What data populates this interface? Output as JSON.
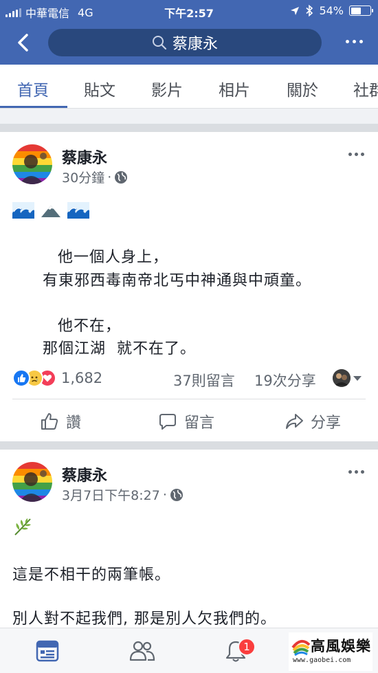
{
  "status_bar": {
    "carrier": "中華電信",
    "network": "4G",
    "time": "下午2:57",
    "battery": "54%",
    "battery_level": 0.54,
    "icons": [
      "signal-icon",
      "location-arrow-icon",
      "bluetooth-icon",
      "battery-icon"
    ]
  },
  "header": {
    "search_text": "蔡康永",
    "icons": [
      "back-arrow-icon",
      "search-icon",
      "more-icon"
    ]
  },
  "tabs": [
    {
      "label": "首頁",
      "active": true
    },
    {
      "label": "貼文",
      "active": false
    },
    {
      "label": "影片",
      "active": false
    },
    {
      "label": "相片",
      "active": false
    },
    {
      "label": "關於",
      "active": false
    },
    {
      "label": "社群",
      "active": false
    }
  ],
  "posts": [
    {
      "author": "蔡康永",
      "time": "30分鐘",
      "separator": "·",
      "emoji": [
        "wave-icon",
        "mountain-icon",
        "wave-icon"
      ],
      "lines": [
        "他一個人身上，",
        "有東邪西毒南帝北丐中神通與中頑童。",
        "他不在，",
        "那個江湖  就不在了。"
      ],
      "reactions": {
        "icons": [
          "like-reaction-icon",
          "sad-reaction-icon",
          "love-reaction-icon"
        ],
        "count": "1,682"
      },
      "comments": "37則留言",
      "shares": "19次分享",
      "actions": {
        "like": "讚",
        "comment": "留言",
        "share": "分享"
      }
    },
    {
      "author": "蔡康永",
      "time": "3月7日下午8:27",
      "separator": "·",
      "emoji": [
        "herb-icon"
      ],
      "lines": [
        "這是不相干的兩筆帳。",
        "別人對不起我們, 那是別人欠我們的。"
      ]
    }
  ],
  "bottom_bar": {
    "icons": [
      "news-feed-icon",
      "friends-icon",
      "notifications-icon"
    ],
    "notification_badge": "1"
  },
  "watermark": {
    "name": "高風娛樂",
    "url": "www.gaobei.com"
  },
  "colors": {
    "brand_blue": "#4267b2",
    "search_pill": "#29487d",
    "badge_red": "#fa3e3e",
    "text_secondary": "#606770"
  }
}
